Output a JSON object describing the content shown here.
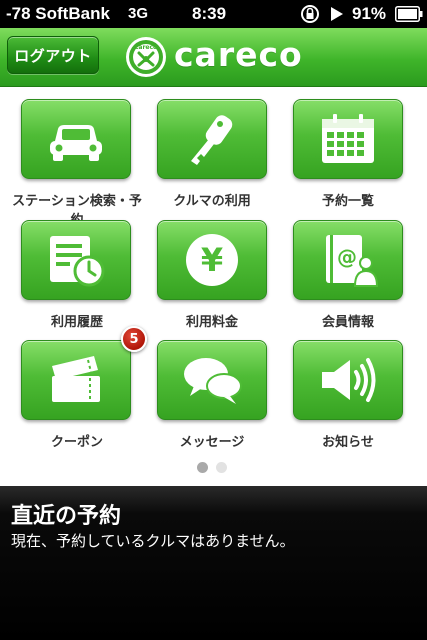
{
  "status_bar": {
    "carrier": "-78 SoftBank",
    "network": "3G",
    "time": "8:39",
    "battery": "91%",
    "icons": [
      "rotation-lock-icon",
      "play-icon",
      "battery-icon"
    ]
  },
  "header": {
    "logout_label": "ログアウト",
    "logo_badge_text": "careco",
    "logo_text": "careco"
  },
  "colors": {
    "accent_green": "#4fbc36",
    "badge_red": "#c8200f",
    "panel_bg": "#000000"
  },
  "menu": {
    "items": [
      {
        "label": "ステーション検索・予約",
        "icon": "car-icon"
      },
      {
        "label": "クルマの利用",
        "icon": "key-icon"
      },
      {
        "label": "予約一覧",
        "icon": "calendar-icon"
      },
      {
        "label": "利用履歴",
        "icon": "history-icon"
      },
      {
        "label": "利用料金",
        "icon": "yen-icon"
      },
      {
        "label": "会員情報",
        "icon": "member-icon"
      },
      {
        "label": "クーポン",
        "icon": "coupon-icon",
        "badge": "5"
      },
      {
        "label": "メッセージ",
        "icon": "message-icon"
      },
      {
        "label": "お知らせ",
        "icon": "speaker-icon"
      }
    ]
  },
  "pagination": {
    "pages": 2,
    "current": 1
  },
  "reservation": {
    "title": "直近の予約",
    "message": "現在、予約しているクルマはありません。"
  }
}
